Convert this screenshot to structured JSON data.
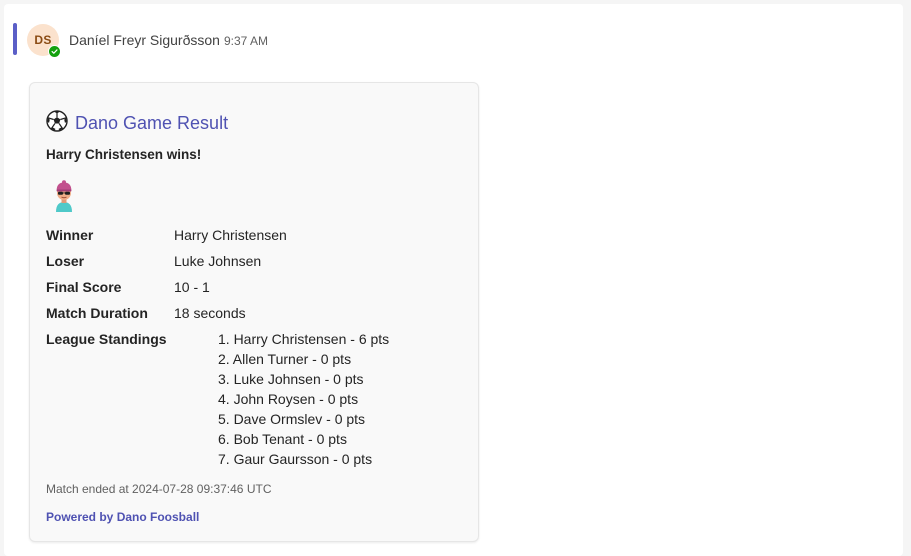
{
  "message": {
    "sender_initials": "DS",
    "sender_name": "Daníel Freyr Sigurðsson",
    "timestamp": "9:37 AM",
    "presence": "available",
    "accent_color": "#5b5fc7"
  },
  "card": {
    "title_icon": "soccer-ball-icon",
    "title": "Dano Game Result",
    "subtitle": "Harry Christensen wins!",
    "winner_image": "player-avatar-icon",
    "facts": [
      {
        "key": "Winner",
        "value": "Harry Christensen"
      },
      {
        "key": "Loser",
        "value": "Luke Johnsen"
      },
      {
        "key": "Final Score",
        "value": "10 - 1"
      },
      {
        "key": "Match Duration",
        "value": "18 seconds"
      }
    ],
    "standings_label": "League Standings",
    "standings": [
      "1. Harry Christensen - 6 pts",
      "2. Allen Turner - 0 pts",
      "3. Luke Johnsen - 0 pts",
      "4. John Roysen - 0 pts",
      "5. Dave Ormslev - 0 pts",
      "6. Bob Tenant - 0 pts",
      "7. Gaur Gaursson - 0 pts"
    ],
    "footer": "Match ended at 2024-07-28 09:37:46 UTC",
    "powered_by": "Powered by Dano Foosball",
    "link_color": "#4f52b2"
  }
}
